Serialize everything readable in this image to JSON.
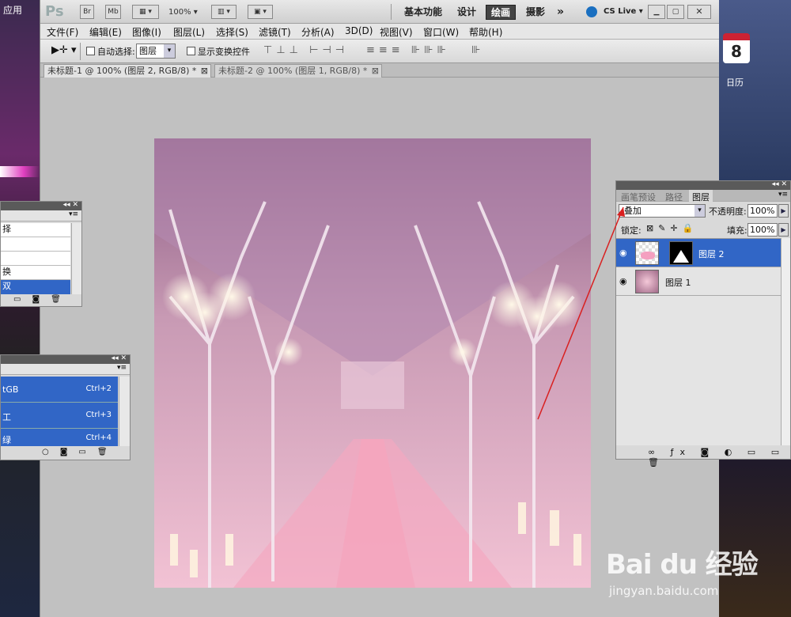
{
  "desktop": {
    "left_label": "应用",
    "calendar_day": "8",
    "calendar_label": "日历"
  },
  "titlebar": {
    "ps_logo": "Ps",
    "br": "Br",
    "mb": "Mb",
    "zoom": "100%",
    "workspaces": [
      "基本功能",
      "设计",
      "绘画",
      "摄影"
    ],
    "more": "»",
    "cslive": "CS Live",
    "cslive_arrow": "▾"
  },
  "menubar": [
    "文件(F)",
    "编辑(E)",
    "图像(I)",
    "图层(L)",
    "选择(S)",
    "滤镜(T)",
    "分析(A)",
    "3D(D)",
    "视图(V)",
    "窗口(W)",
    "帮助(H)"
  ],
  "options": {
    "auto_select_label": "自动选择:",
    "auto_select_value": "图层",
    "show_transform_label": "显示变换控件"
  },
  "tabs": [
    {
      "label": "未标题-1 @ 100% (图层 2, RGB/8) *"
    },
    {
      "label": "未标题-2 @ 100% (图层 1, RGB/8) *"
    }
  ],
  "left_panel_a": {
    "rows": [
      "择",
      "",
      "",
      "换",
      "双"
    ]
  },
  "left_panel_b": {
    "rows": [
      {
        "label": "tGB",
        "shortcut": "Ctrl+2"
      },
      {
        "label": "工",
        "shortcut": "Ctrl+3"
      },
      {
        "label": "绿",
        "shortcut": "Ctrl+4"
      }
    ]
  },
  "layers_panel": {
    "tabs": [
      "画笔预设",
      "路径",
      "图层"
    ],
    "blend_mode": "叠加",
    "opacity_label": "不透明度:",
    "opacity_value": "100%",
    "lock_label": "锁定:",
    "fill_label": "填充:",
    "fill_value": "100%",
    "layers": [
      {
        "name": "图层 2",
        "selected": true
      },
      {
        "name": "图层 1",
        "selected": false
      }
    ]
  },
  "watermark": {
    "logo": "Bai du 经验",
    "url": "jingyan.baidu.com"
  },
  "colors": {
    "selection": "#3166c6",
    "active_workspace": "#444444",
    "arrow": "#d92020"
  }
}
